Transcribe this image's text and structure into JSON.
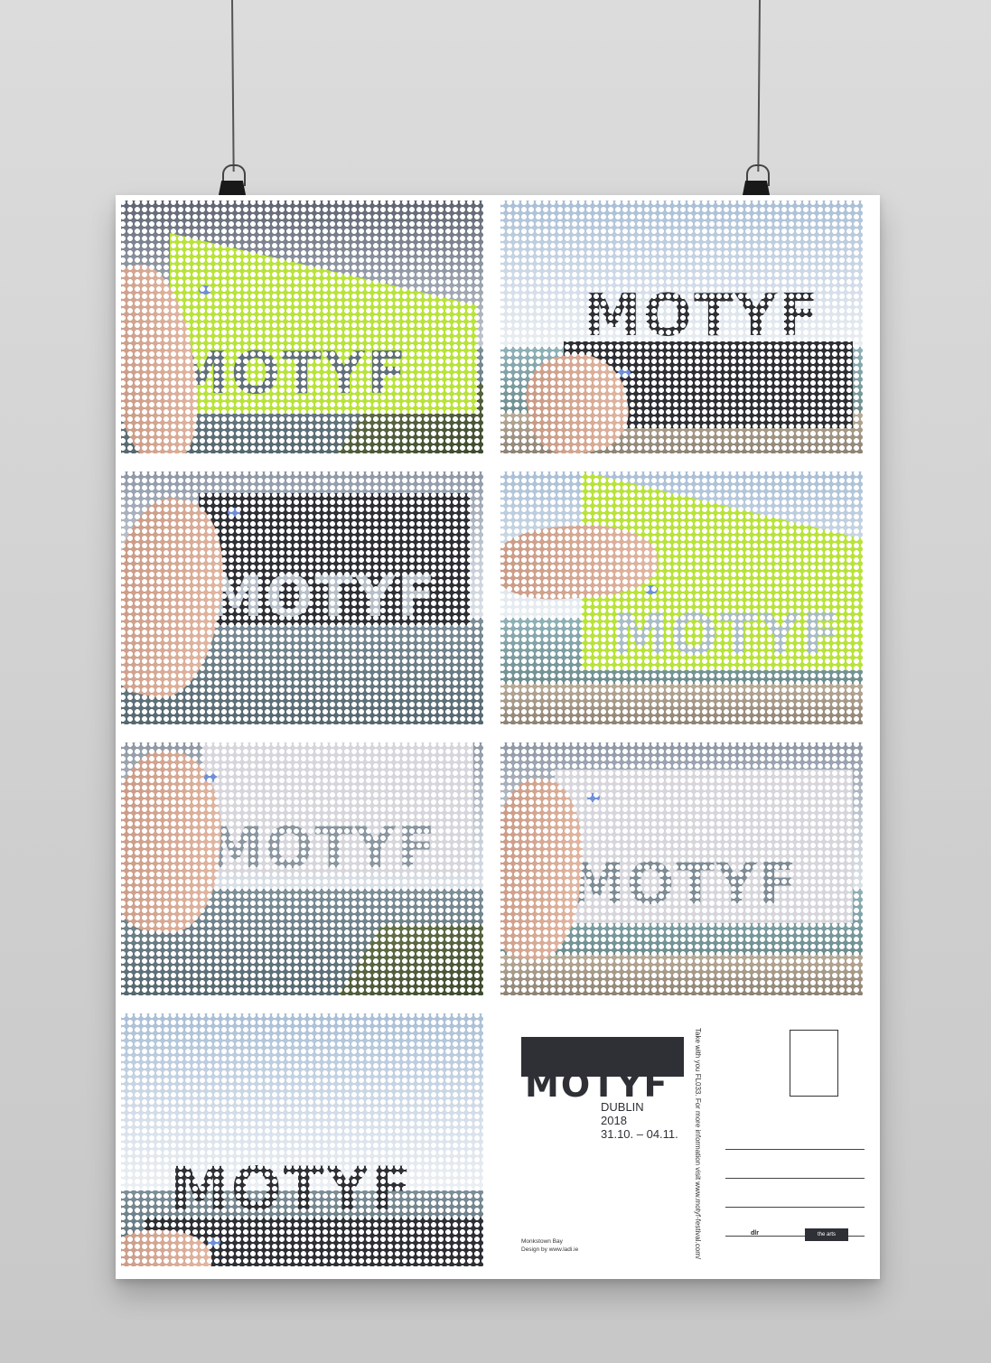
{
  "poster": {
    "photos": [
      {
        "word": "MOTYF",
        "card": "lime"
      },
      {
        "word": "MOTYF",
        "card": "dark"
      },
      {
        "word": "MOTYF",
        "card": "dark"
      },
      {
        "word": "MOTYF",
        "card": "lime"
      },
      {
        "word": "MOTYF",
        "card": "pale"
      },
      {
        "word": "MOTYF",
        "card": "pale"
      },
      {
        "word": "MOTYF",
        "card": "dark"
      }
    ],
    "postcard": {
      "logo": "MOTYF",
      "city": "DUBLIN",
      "year": "2018",
      "dates": "31.10. – 04.11.",
      "vertical_text": "Take with you FL033.  For more information visit www.motyf-festival.com/",
      "credit_line1": "Monkstown Bay",
      "credit_line2": "Design  by www.ladi.ie",
      "sponsor1": "dlr",
      "sponsor2": "the arts"
    }
  },
  "colors": {
    "lime": "#b9e33a",
    "dark": "#2e3036",
    "pale": "#d6d6dc"
  }
}
